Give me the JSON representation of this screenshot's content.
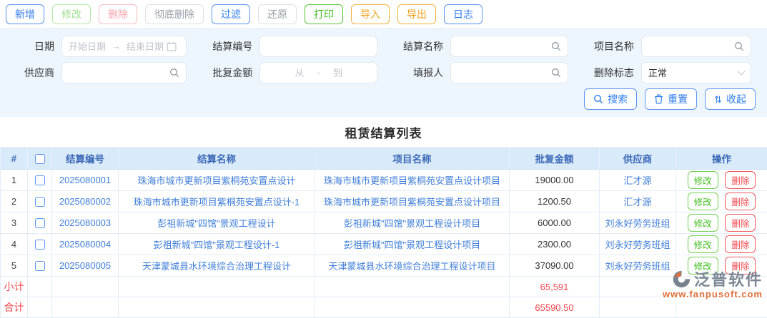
{
  "toolbar": {
    "buttons": [
      {
        "label": "新增"
      },
      {
        "label": "修改"
      },
      {
        "label": "删除"
      },
      {
        "label": "彻底删除"
      },
      {
        "label": "过滤"
      },
      {
        "label": "还原"
      },
      {
        "label": "打印"
      },
      {
        "label": "导入"
      },
      {
        "label": "导出"
      },
      {
        "label": "日志"
      }
    ]
  },
  "filters": {
    "date_label": "日期",
    "date_start_placeholder": "开始日期",
    "date_arrow": "→",
    "date_end_placeholder": "结束日期",
    "settlement_no_label": "结算编号",
    "settlement_name_label": "结算名称",
    "project_name_label": "项目名称",
    "supplier_label": "供应商",
    "amount_label": "批复金额",
    "amount_from_placeholder": "从",
    "amount_separator": "-",
    "amount_to_placeholder": "到",
    "filler_label": "填报人",
    "delete_flag_label": "删除标志",
    "delete_flag_value": "正常",
    "search_button": "搜索",
    "reset_button": "重置",
    "collapse_button": "收起"
  },
  "page_title": "租赁结算列表",
  "table": {
    "headers": {
      "index": "#",
      "settlement_no": "结算编号",
      "settlement_name": "结算名称",
      "project_name": "项目名称",
      "approved_amount": "批复金额",
      "supplier": "供应商",
      "operation": "操作"
    },
    "modify_label": "修改",
    "delete_label": "删除",
    "rows": [
      {
        "index": "1",
        "no": "2025080001",
        "name": "珠海市城市更新项目紫桐苑安置点设计",
        "project": "珠海市城市更新项目紫桐苑安置点设计项目",
        "amount": "19000.00",
        "supplier": "汇才源"
      },
      {
        "index": "2",
        "no": "2025080002",
        "name": "珠海市城市更新项目紫桐苑安置点设计-1",
        "project": "珠海市城市更新项目紫桐苑安置点设计项目",
        "amount": "1200.50",
        "supplier": "汇才源"
      },
      {
        "index": "3",
        "no": "2025080003",
        "name": "彭祖新城\"四馆\"景观工程设计",
        "project": "彭祖新城\"四馆\"景观工程设计项目",
        "amount": "6000.00",
        "supplier": "刘永好劳务班组"
      },
      {
        "index": "4",
        "no": "2025080004",
        "name": "彭祖新城\"四馆\"景观工程设计-1",
        "project": "彭祖新城\"四馆\"景观工程设计项目",
        "amount": "2300.00",
        "supplier": "刘永好劳务班组"
      },
      {
        "index": "5",
        "no": "2025080005",
        "name": "天津蒙城县水环境综合治理工程设计",
        "project": "天津蒙城县水环境综合治理工程设计项目",
        "amount": "37090.00",
        "supplier": "刘永好劳务班组"
      }
    ],
    "subtotal_label": "小计",
    "subtotal_amount": "65,591",
    "total_label": "合计",
    "total_amount": "65590.50"
  },
  "watermark": {
    "brand": "泛普软件",
    "url": "www.fanpusoft.com"
  },
  "colors": {
    "accent_blue": "#2e7cf0",
    "header_bg": "#d9eafb",
    "header_text": "#3a68b5",
    "filter_bg": "#eef6fd",
    "link_blue": "#3f7ed8",
    "total_red": "#f5454d",
    "edit_green": "#3fbd1c",
    "delete_red": "#f0474d",
    "orange": "#f0a11a"
  }
}
